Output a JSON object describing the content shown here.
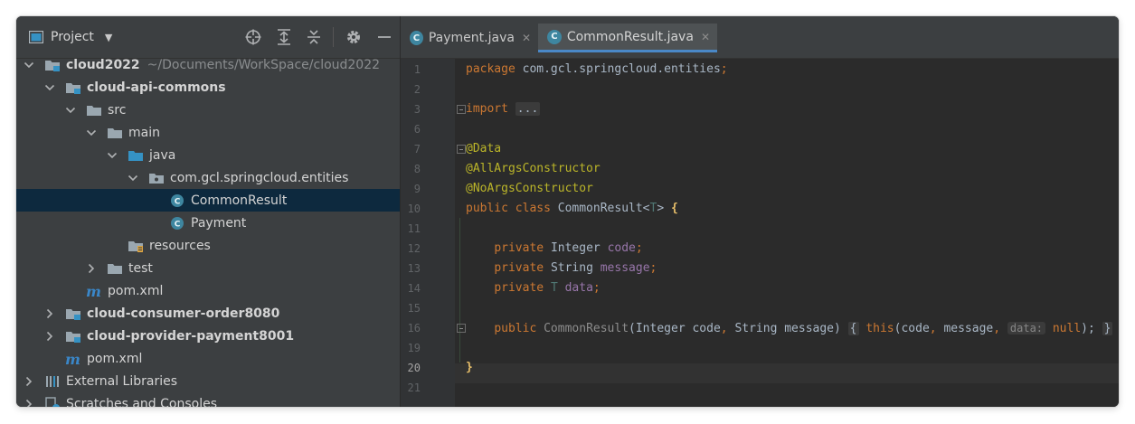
{
  "project_panel": {
    "title": "Project",
    "tree": [
      {
        "label": "cloud2022",
        "path": "~/Documents/WorkSpace/cloud2022",
        "depth": 0,
        "expanded": true,
        "icon": "module-folder-icon",
        "bold": true
      },
      {
        "label": "cloud-api-commons",
        "depth": 1,
        "expanded": true,
        "icon": "module-folder-icon",
        "bold": true
      },
      {
        "label": "src",
        "depth": 2,
        "expanded": true,
        "icon": "folder-icon"
      },
      {
        "label": "main",
        "depth": 3,
        "expanded": true,
        "icon": "folder-icon"
      },
      {
        "label": "java",
        "depth": 4,
        "expanded": true,
        "icon": "source-folder-icon"
      },
      {
        "label": "com.gcl.springcloud.entities",
        "depth": 5,
        "expanded": true,
        "icon": "package-icon"
      },
      {
        "label": "CommonResult",
        "depth": 6,
        "icon": "class-icon",
        "selected": true
      },
      {
        "label": "Payment",
        "depth": 6,
        "icon": "class-icon"
      },
      {
        "label": "resources",
        "depth": 4,
        "icon": "resources-folder-icon"
      },
      {
        "label": "test",
        "depth": 3,
        "expanded": false,
        "icon": "folder-icon"
      },
      {
        "label": "pom.xml",
        "depth": 2,
        "icon": "maven-icon"
      },
      {
        "label": "cloud-consumer-order8080",
        "depth": 1,
        "expanded": false,
        "icon": "module-folder-icon",
        "bold": true
      },
      {
        "label": "cloud-provider-payment8001",
        "depth": 1,
        "expanded": false,
        "icon": "module-folder-icon",
        "bold": true
      },
      {
        "label": "pom.xml",
        "depth": 1,
        "icon": "maven-icon"
      },
      {
        "label": "External Libraries",
        "depth": 0,
        "expanded": false,
        "icon": "libraries-icon"
      },
      {
        "label": "Scratches and Consoles",
        "depth": 0,
        "expanded": false,
        "icon": "scratches-icon"
      }
    ]
  },
  "tabs": [
    {
      "label": "Payment.java",
      "icon_letter": "C",
      "active": false
    },
    {
      "label": "CommonResult.java",
      "icon_letter": "C",
      "active": true
    }
  ],
  "editor": {
    "current_line": "20",
    "lines": [
      {
        "n": "1",
        "tokens": [
          [
            "kw",
            "package "
          ],
          [
            "",
            "com.gcl.springcloud.entities"
          ],
          [
            "kw",
            ";"
          ]
        ]
      },
      {
        "n": "2",
        "tokens": []
      },
      {
        "n": "3",
        "tokens": [
          [
            "kw",
            "import "
          ],
          [
            "fold",
            "..."
          ]
        ],
        "fold": true
      },
      {
        "n": "6",
        "tokens": []
      },
      {
        "n": "7",
        "tokens": [
          [
            "ann",
            "@Data"
          ]
        ],
        "fold": true
      },
      {
        "n": "8",
        "tokens": [
          [
            "ann",
            "@AllArgsConstructor"
          ]
        ]
      },
      {
        "n": "9",
        "tokens": [
          [
            "ann",
            "@NoArgsConstructor"
          ]
        ]
      },
      {
        "n": "10",
        "tokens": [
          [
            "kw",
            "public class "
          ],
          [
            "",
            "CommonResult<"
          ],
          [
            "tp",
            "T"
          ],
          [
            "",
            "> "
          ],
          [
            "br",
            "{"
          ]
        ]
      },
      {
        "n": "11",
        "tokens": []
      },
      {
        "n": "12",
        "tokens": [
          [
            "",
            "    "
          ],
          [
            "kw",
            "private "
          ],
          [
            "",
            "Integer "
          ],
          [
            "fld",
            "code"
          ],
          [
            "kw",
            ";"
          ]
        ]
      },
      {
        "n": "13",
        "tokens": [
          [
            "",
            "    "
          ],
          [
            "kw",
            "private "
          ],
          [
            "",
            "String "
          ],
          [
            "fld",
            "message"
          ],
          [
            "kw",
            ";"
          ]
        ]
      },
      {
        "n": "14",
        "tokens": [
          [
            "",
            "    "
          ],
          [
            "kw",
            "private "
          ],
          [
            "tp",
            "T "
          ],
          [
            "fld",
            "data"
          ],
          [
            "kw",
            ";"
          ]
        ]
      },
      {
        "n": "15",
        "tokens": []
      },
      {
        "n": "16",
        "tokens": [
          [
            "",
            "    "
          ],
          [
            "kw",
            "public "
          ],
          [
            "gray",
            "CommonResult"
          ],
          [
            "",
            "(Integer code"
          ],
          [
            "kw",
            ", "
          ],
          [
            "",
            "String message) "
          ],
          [
            "fold",
            "{"
          ],
          [
            "",
            " "
          ],
          [
            "kw",
            "this"
          ],
          [
            "",
            "(code"
          ],
          [
            "kw",
            ", "
          ],
          [
            "",
            "message"
          ],
          [
            "kw",
            ", "
          ],
          [
            "",
            ""
          ],
          [
            "hint",
            "data:"
          ],
          [
            "kw",
            " null"
          ],
          [
            "",
            "); "
          ],
          [
            "fold",
            "}"
          ]
        ],
        "fold": true
      },
      {
        "n": "19",
        "tokens": []
      },
      {
        "n": "20",
        "tokens": [
          [
            "br",
            "}"
          ]
        ]
      },
      {
        "n": "21",
        "tokens": []
      }
    ]
  }
}
